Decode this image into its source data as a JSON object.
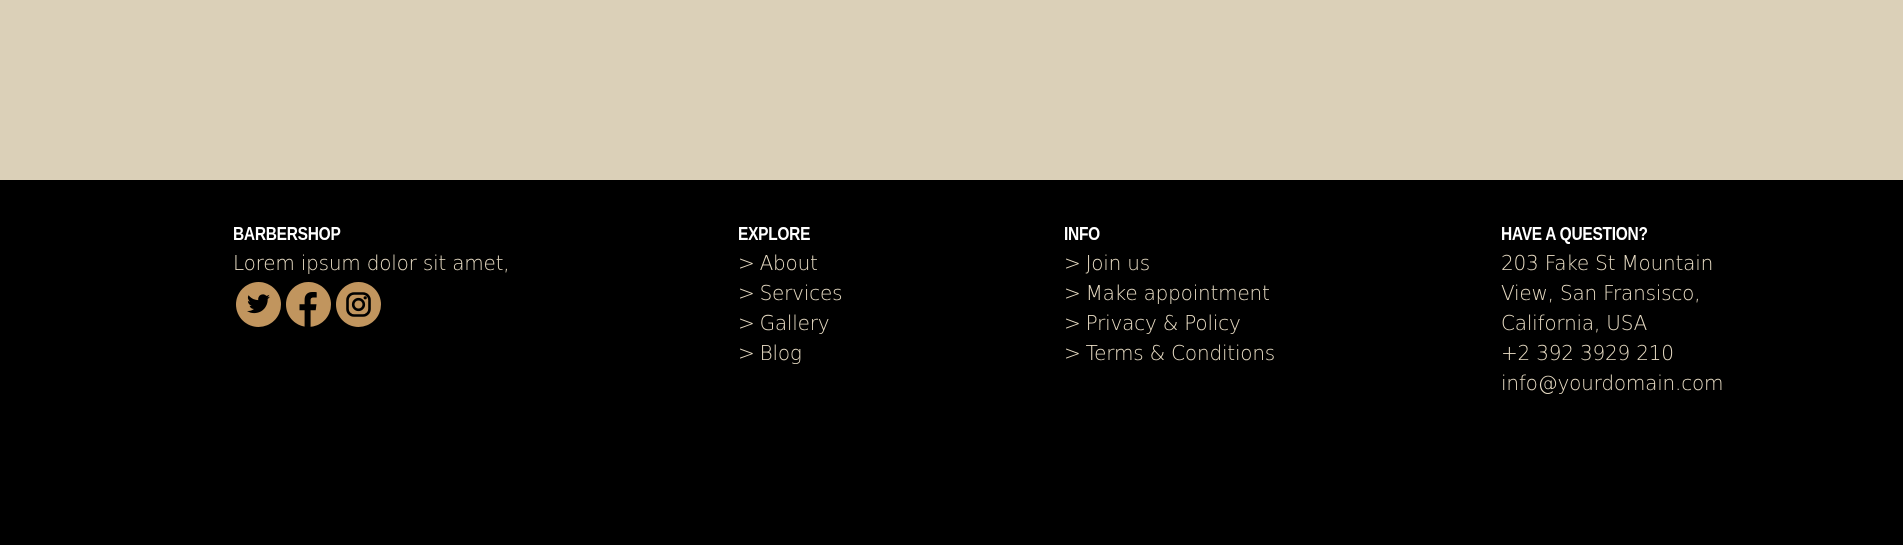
{
  "footer": {
    "brand": {
      "title": "BARBERSHOP",
      "text": "Lorem ipsum dolor sit amet,",
      "socials": [
        {
          "name": "twitter",
          "icon": "twitter-icon"
        },
        {
          "name": "facebook",
          "icon": "facebook-icon"
        },
        {
          "name": "instagram",
          "icon": "instagram-icon"
        }
      ]
    },
    "explore": {
      "title": "EXPLORE",
      "links": [
        "About",
        "Services",
        "Gallery",
        "Blog"
      ]
    },
    "info": {
      "title": "INFO",
      "links": [
        "Join us",
        "Make appointment",
        "Privacy & Policy",
        "Terms & Conditions"
      ]
    },
    "contact": {
      "title": "HAVE A QUESTION?",
      "address_lines": [
        "203 Fake St Mountain",
        "View, San Fransisco,",
        "California, USA"
      ],
      "phone": "+2 392 3929 210",
      "email": "info@yourdomain.com"
    },
    "link_prefix": ">"
  },
  "colors": {
    "top_band": "#dbd0b8",
    "footer_bg": "#000000",
    "accent": "#c1955e",
    "text": "#e8dcc4",
    "heading": "#ffffff"
  }
}
